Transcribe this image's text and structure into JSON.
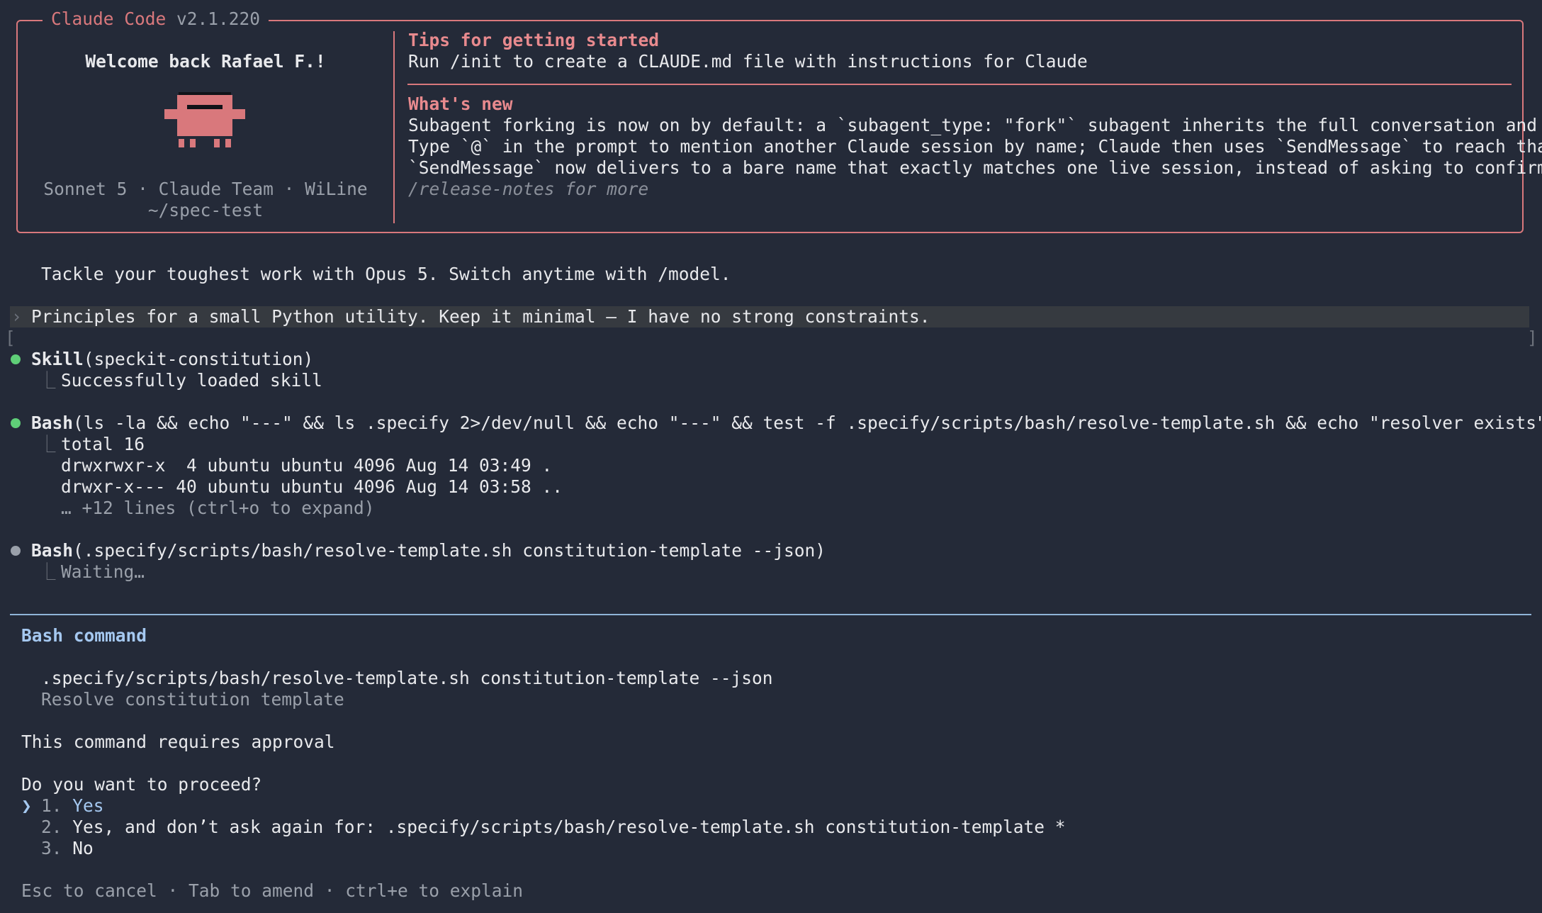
{
  "header": {
    "app_name": "Claude Code",
    "version": "v2.1.220"
  },
  "welcome": {
    "greeting": "Welcome back Rafael F.!",
    "meta_line": "Sonnet 5 · Claude Team · WiLine",
    "cwd": "~/spec-test"
  },
  "tips": {
    "heading": "Tips for getting started",
    "line": "Run /init to create a CLAUDE.md file with instructions for Claude"
  },
  "whats_new": {
    "heading": "What's new",
    "items": [
      "Subagent forking is now on by default: a `subagent_type: \"fork\"` subagent inherits the full conversation and p…",
      "Type `@` in the prompt to mention another Claude session by name; Claude then uses `SendMessage` to reach that…",
      "`SendMessage` now delivers to a bare name that exactly matches one live session, instead of asking to confirm …"
    ],
    "more": "/release-notes for more"
  },
  "notice": "Tackle your toughest work with Opus 5. Switch anytime with /model.",
  "prompt": {
    "chevron": "›",
    "text": "Principles for a small Python utility. Keep it minimal — I have no strong constraints."
  },
  "brackets": {
    "left": "[",
    "right": "]"
  },
  "tree_glyph": "⎿",
  "tools": [
    {
      "name": "Skill",
      "args": "(speckit-constitution)",
      "status": "done",
      "output": [
        "Successfully loaded skill"
      ]
    },
    {
      "name": "Bash",
      "args": "(ls -la && echo \"---\" && ls .specify 2>/dev/null && echo \"---\" && test -f .specify/scripts/bash/resolve-template.sh && echo \"resolver exists\")",
      "status": "done",
      "output": [
        "total 16",
        "drwxrwxr-x  4 ubuntu ubuntu 4096 Aug 14 03:49 .",
        "drwxr-x--- 40 ubuntu ubuntu 4096 Aug 14 03:58 .."
      ],
      "more": "… +12 lines (ctrl+o to expand)"
    },
    {
      "name": "Bash",
      "args": "(.specify/scripts/bash/resolve-template.sh constitution-template --json)",
      "status": "pending",
      "output": [
        "Waiting…"
      ]
    }
  ],
  "approval": {
    "title": "Bash command",
    "command": ".specify/scripts/bash/resolve-template.sh constitution-template --json",
    "description": "Resolve constitution template",
    "requires": "This command requires approval",
    "question": "Do you want to proceed?",
    "cursor": "❯",
    "options": [
      {
        "num": "1.",
        "label": "Yes"
      },
      {
        "num": "2.",
        "label": "Yes, and don’t ask again for: .specify/scripts/bash/resolve-template.sh constitution-template *"
      },
      {
        "num": "3.",
        "label": "No"
      }
    ],
    "footer": "Esc to cancel · Tab to amend · ctrl+e to explain"
  },
  "colors": {
    "background": "#242a38",
    "accent": "#d9787c",
    "success": "#5fcf78",
    "selection": "#a5c8f0"
  }
}
